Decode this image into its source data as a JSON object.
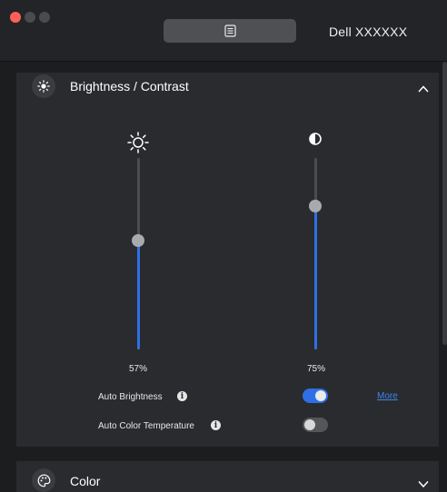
{
  "window": {
    "monitor_name": "Dell XXXXXX",
    "tab_icon": "document-list-icon"
  },
  "brightness_contrast": {
    "title": "Brightness / Contrast",
    "icon": "sun-icon",
    "collapse_icon": "chevron-up-icon",
    "brightness": {
      "icon": "sun-outline-icon",
      "value": 57,
      "label": "57%"
    },
    "contrast": {
      "icon": "contrast-half-circle-icon",
      "value": 75,
      "label": "75%"
    },
    "auto_brightness": {
      "label": "Auto Brightness",
      "enabled": true,
      "more_label": "More"
    },
    "auto_color_temperature": {
      "label": "Auto Color Temperature",
      "enabled": false
    }
  },
  "color": {
    "title": "Color",
    "icon": "palette-icon",
    "expand_icon": "chevron-down-icon"
  },
  "colors": {
    "accent": "#2f6fe6",
    "link": "#3d86f0",
    "panel": "#2a2b2e",
    "background": "#1c1d1f"
  }
}
